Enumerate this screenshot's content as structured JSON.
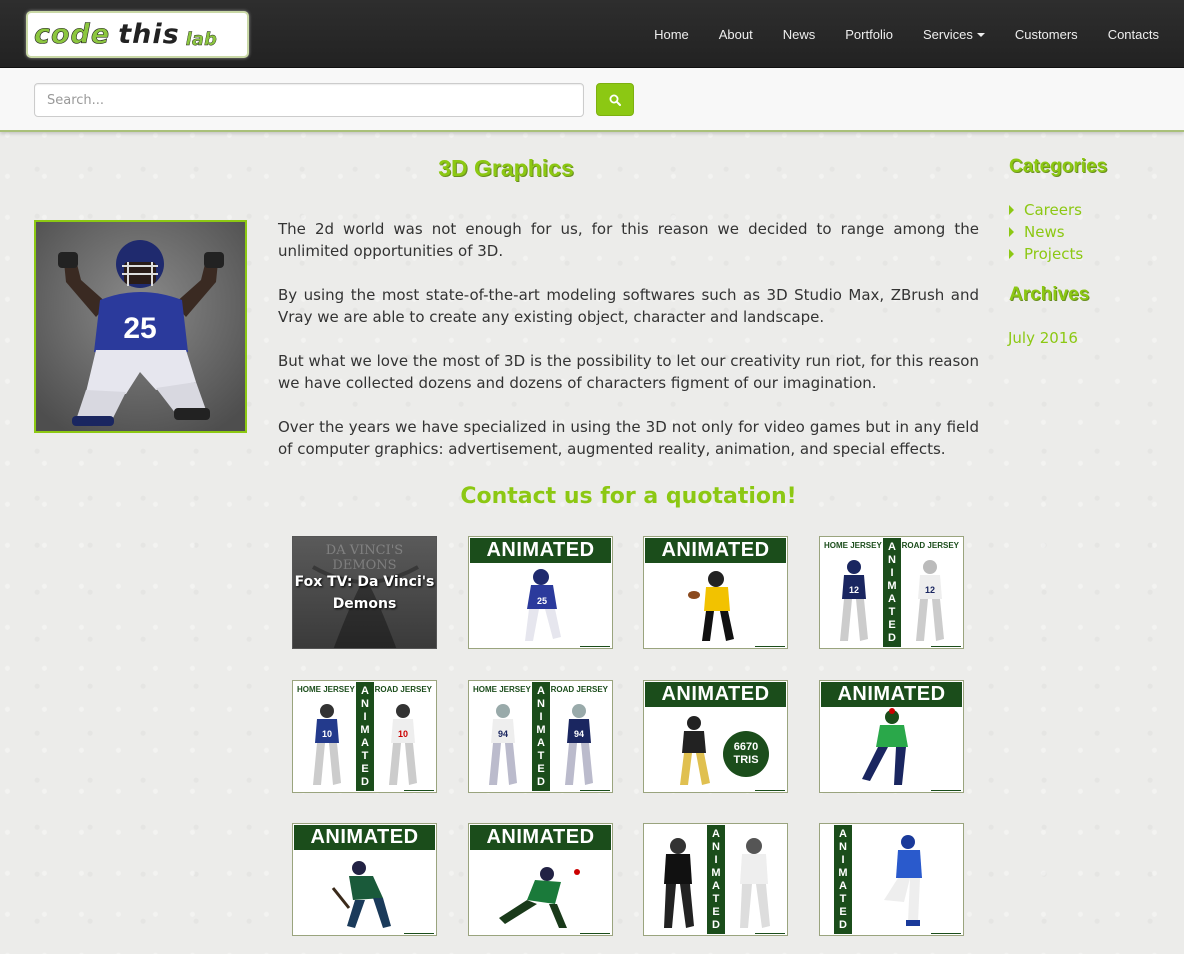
{
  "brand": {
    "word1": "code",
    "word2": "this",
    "word3": "lab"
  },
  "nav": {
    "items": [
      "Home",
      "About",
      "News",
      "Portfolio",
      "Services",
      "Customers",
      "Contacts"
    ]
  },
  "search": {
    "placeholder": "Search..."
  },
  "page": {
    "title": "3D Graphics",
    "paragraphs": [
      "The 2d world was not enough for us, for this reason we decided to range among the unlimited opportunities of 3D.",
      "By using the most state-of-the-art modeling softwares such as 3D Studio Max, ZBrush and Vray we are able to create any existing object, character and landscape.",
      "But what we love the most of 3D is the possibility to let our creativity run riot, for this reason we have collected dozens and dozens of characters figment of our imagination.",
      "Over the years we have specialized in using the 3D not only for video games but in any field of computer graphics: advertisement, augmented reality, animation, and special effects."
    ],
    "cta": "Contact us for a quotation!",
    "hero_number": "25"
  },
  "thumbs": {
    "caption": "Fox TV: Da Vinci's Demons",
    "caption_bg": "DA VINCI'S DEMONS",
    "animated": "ANIMATED",
    "home_jersey": "HOME JERSEY",
    "road_jersey": "ROAD JERSEY",
    "tris_count": "6670",
    "tris_label": "TRIS",
    "jersey_numbers": [
      "25",
      "12",
      "10",
      "94"
    ]
  },
  "sidebar": {
    "categories_title": "Categories",
    "categories": [
      "Careers",
      "News",
      "Projects"
    ],
    "archives_title": "Archives",
    "archives": [
      "July 2016"
    ]
  },
  "colors": {
    "accent": "#8cc813",
    "banner": "#1b4d1b",
    "navbar": "#222222"
  }
}
